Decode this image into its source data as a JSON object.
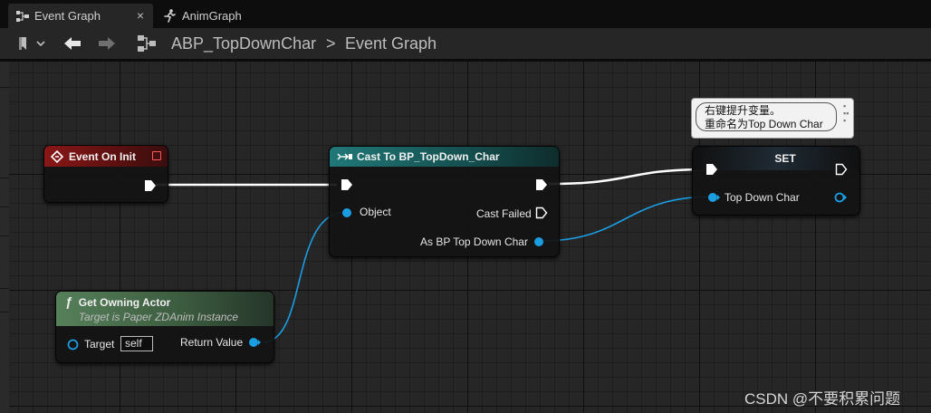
{
  "tabs": [
    {
      "label": "Event Graph",
      "icon": "event-graph-icon",
      "active": true,
      "close": "×"
    },
    {
      "label": "AnimGraph",
      "icon": "running-man-icon",
      "active": false
    }
  ],
  "toolbar": {
    "bookmark_icon": "bookmark-icon",
    "back_icon": "arrow-left-icon",
    "forward_icon": "arrow-right-icon",
    "graph_icon": "graph-icon",
    "breadcrumb_root": "ABP_TopDownChar",
    "breadcrumb_sep": ">",
    "breadcrumb_leaf": "Event Graph"
  },
  "nodes": {
    "event_on_init": {
      "title": "Event On Init",
      "header_color": "#7a1414"
    },
    "cast": {
      "title": "Cast To BP_TopDown_Char",
      "header_color": "#1f6b6b",
      "object_label": "Object",
      "cast_failed_label": "Cast Failed",
      "as_label": "As BP Top Down Char"
    },
    "get_owning_actor": {
      "title": "Get Owning Actor",
      "subtitle": "Target is Paper ZDAnim Instance",
      "header_color": "#4d6e4d",
      "target_label": "Target",
      "target_value": "self",
      "return_label": "Return Value",
      "func_glyph": "ƒ"
    },
    "set": {
      "title": "SET",
      "var_label": "Top Down Char"
    }
  },
  "tooltip": {
    "line1": "右键提升变量。",
    "line2": "重命名为Top Down Char"
  },
  "pin_color": "#1b9de2",
  "exec_color": "#ffffff",
  "watermark": "CSDN @不要积累问题"
}
